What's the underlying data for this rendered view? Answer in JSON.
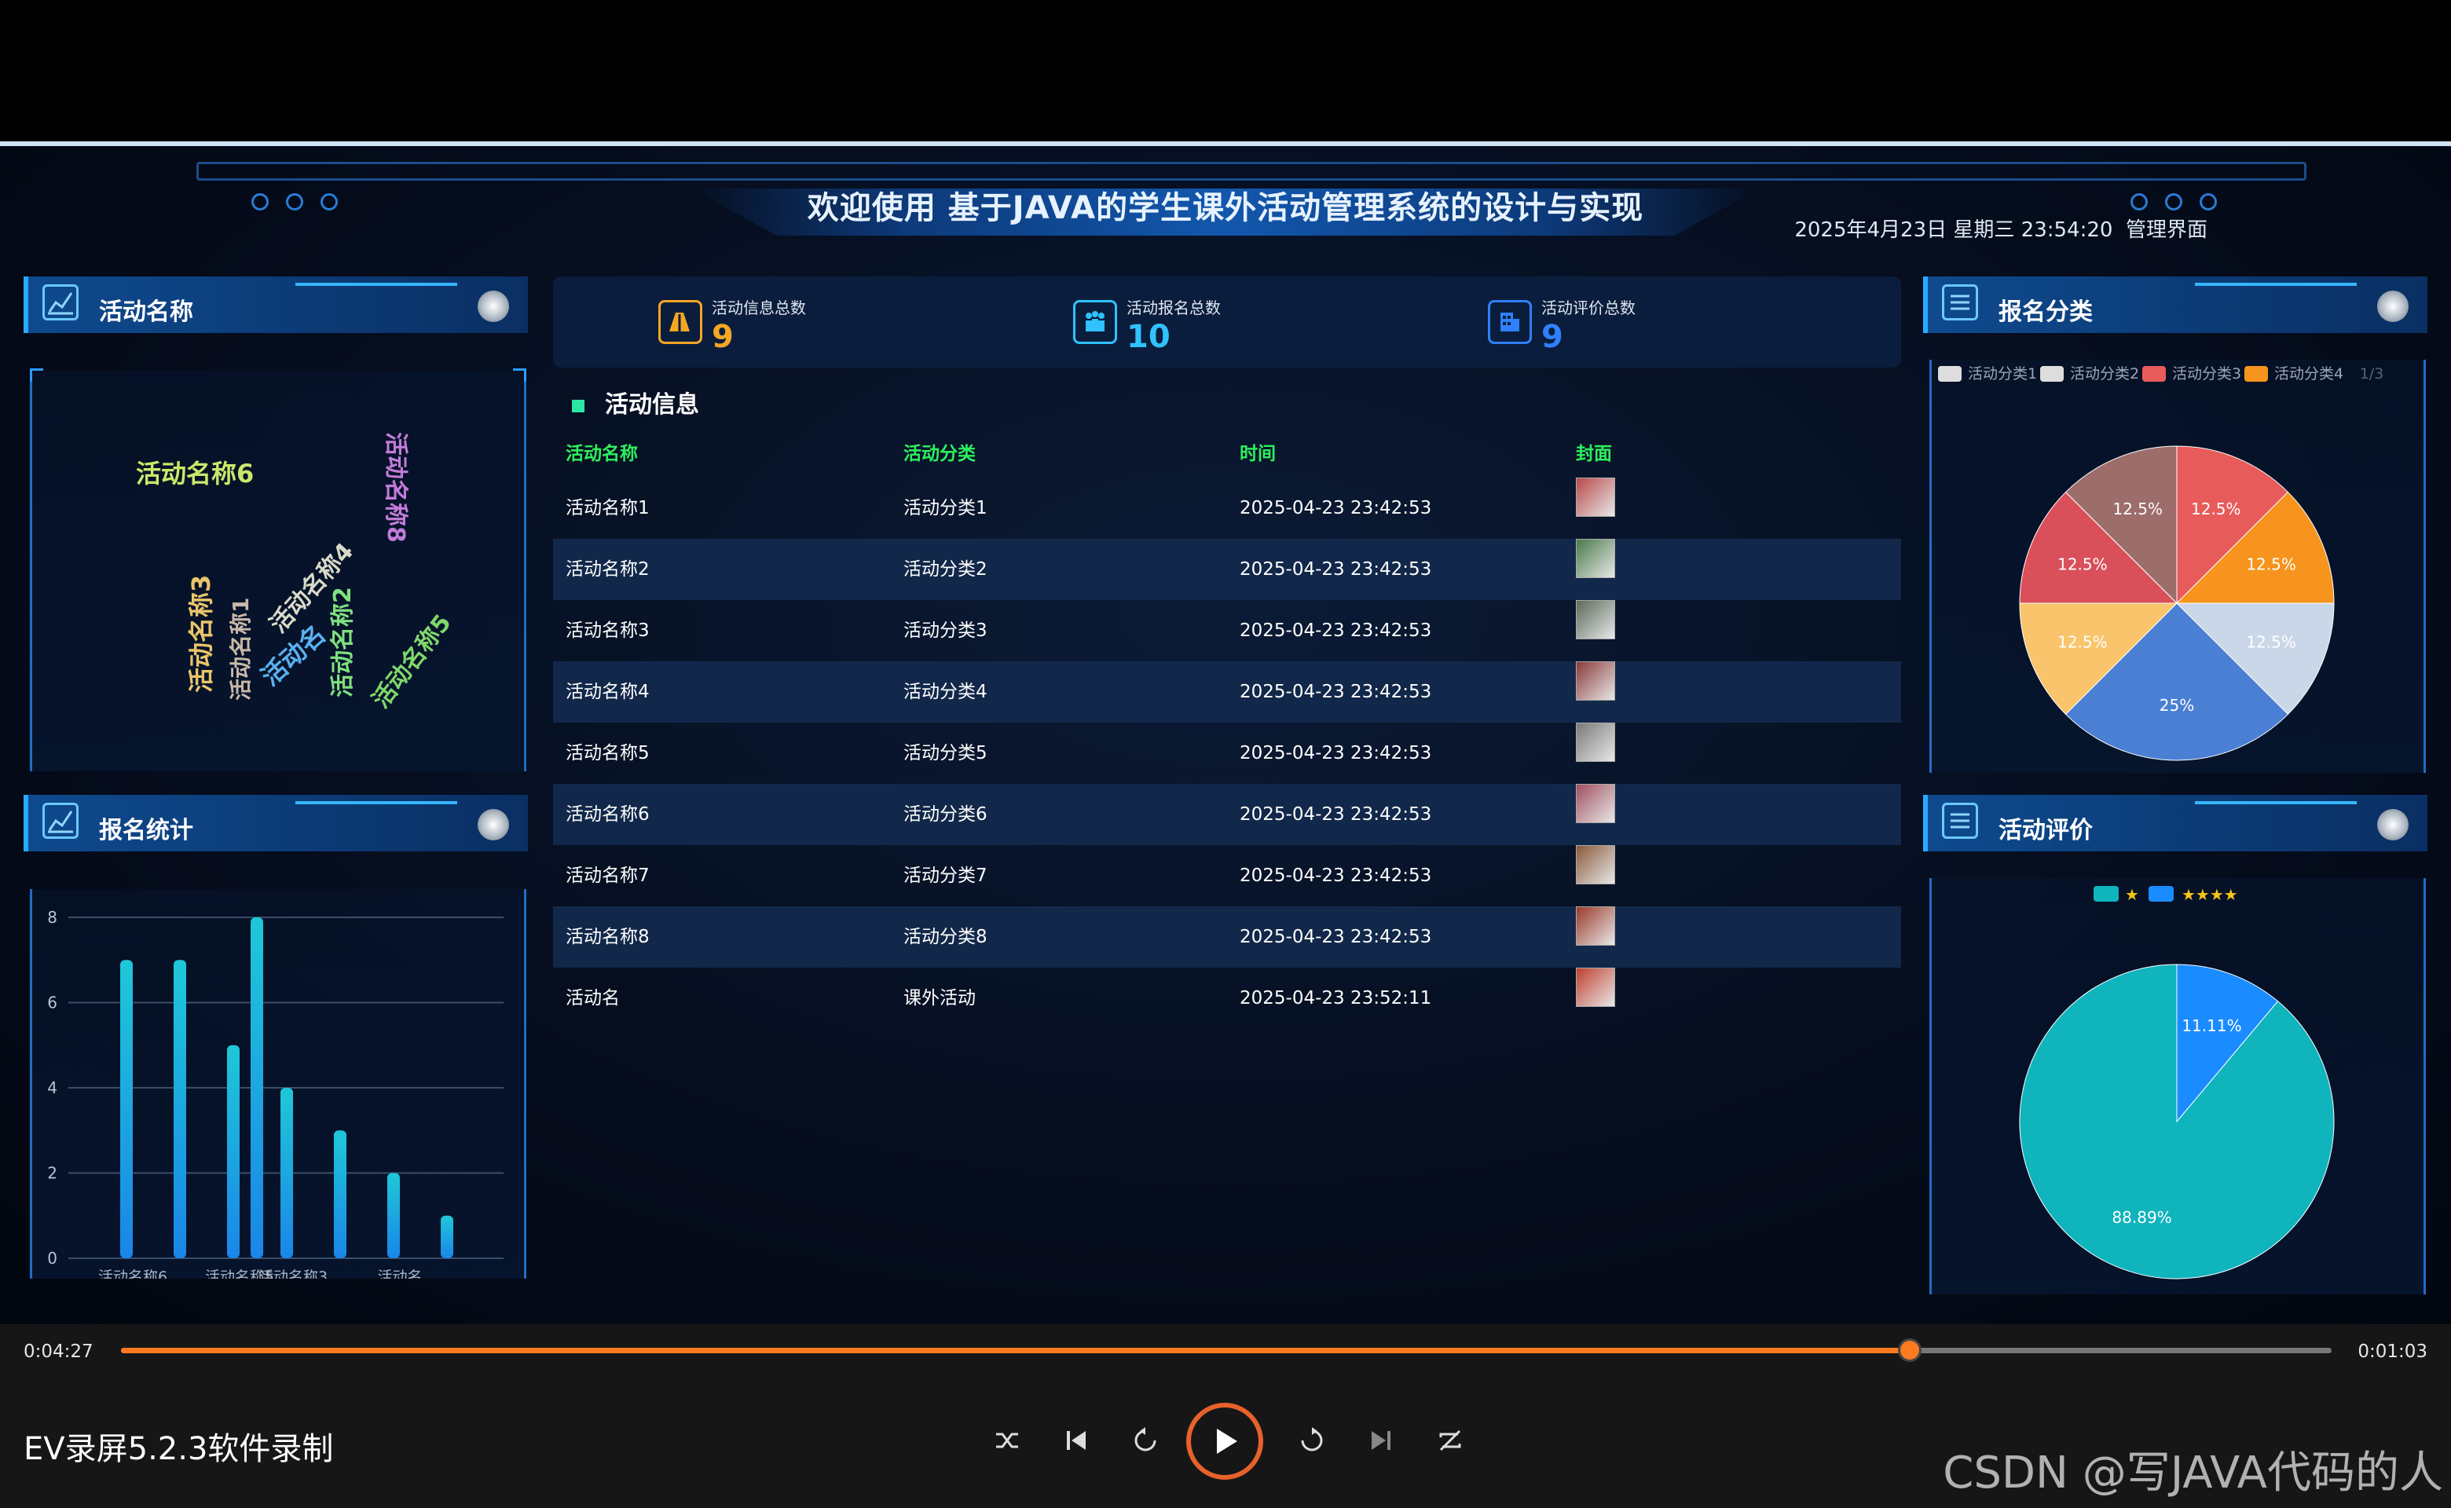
{
  "header": {
    "title": "欢迎使用 基于JAVA的学生课外活动管理系统的设计与实现",
    "datetime": "2025年4月23日 星期三 23:54:20",
    "admin_link": "管理界面"
  },
  "panels": {
    "activity_name": {
      "title": "活动名称"
    },
    "signup_stats": {
      "title": "报名统计"
    },
    "signup_category": {
      "title": "报名分类"
    },
    "activity_rating": {
      "title": "活动评价"
    }
  },
  "word_cloud": [
    {
      "text": "活动名称6",
      "color": "#c8e86a"
    },
    {
      "text": "活动名称3",
      "color": "#e9c46a"
    },
    {
      "text": "活动名称1",
      "color": "#c9b8a8"
    },
    {
      "text": "活动名",
      "color": "#5ab0f0"
    },
    {
      "text": "活动名称4",
      "color": "#d9d9c8"
    },
    {
      "text": "活动名称2",
      "color": "#7ee07e"
    },
    {
      "text": "活动名称8",
      "color": "#c27bd8"
    },
    {
      "text": "活动名称5",
      "color": "#7fd86a"
    }
  ],
  "stats": [
    {
      "label": "活动信息总数",
      "value": "9",
      "color": "#f5a623",
      "icon": "building-icon"
    },
    {
      "label": "活动报名总数",
      "value": "10",
      "color": "#2fc2ff",
      "icon": "people-icon"
    },
    {
      "label": "活动评价总数",
      "value": "9",
      "color": "#2f80ff",
      "icon": "office-icon"
    }
  ],
  "table": {
    "section_title": "活动信息",
    "headers": [
      "活动名称",
      "活动分类",
      "时间",
      "封面"
    ],
    "rows": [
      {
        "name": "活动名称1",
        "category": "活动分类1",
        "time": "2025-04-23 23:42:53"
      },
      {
        "name": "活动名称2",
        "category": "活动分类2",
        "time": "2025-04-23 23:42:53"
      },
      {
        "name": "活动名称3",
        "category": "活动分类3",
        "time": "2025-04-23 23:42:53"
      },
      {
        "name": "活动名称4",
        "category": "活动分类4",
        "time": "2025-04-23 23:42:53"
      },
      {
        "name": "活动名称5",
        "category": "活动分类5",
        "time": "2025-04-23 23:42:53"
      },
      {
        "name": "活动名称6",
        "category": "活动分类6",
        "time": "2025-04-23 23:42:53"
      },
      {
        "name": "活动名称7",
        "category": "活动分类7",
        "time": "2025-04-23 23:42:53"
      },
      {
        "name": "活动名称8",
        "category": "活动分类8",
        "time": "2025-04-23 23:42:53"
      },
      {
        "name": "活动名",
        "category": "课外活动",
        "time": "2025-04-23 23:52:11"
      }
    ]
  },
  "chart_data": [
    {
      "type": "bar",
      "title": "报名统计",
      "categories": [
        "活动名称6",
        "",
        "活动名称5",
        "",
        "活动名称3",
        "",
        "活动名",
        ""
      ],
      "values": [
        7,
        7,
        5,
        8,
        4,
        3,
        2,
        1
      ],
      "ylim": [
        0,
        8
      ],
      "yticks": [
        "0",
        "2",
        "4",
        "6",
        "8"
      ],
      "grid": true,
      "colors": [
        "#1ec8d8",
        "#1a86e8"
      ]
    },
    {
      "type": "pie",
      "title": "报名分类",
      "legend": [
        "活动分类1",
        "活动分类2",
        "活动分类3",
        "活动分类4"
      ],
      "legend_page": "1/3",
      "slices": [
        {
          "label": "12.5%",
          "value": 12.5,
          "color": "#e85b5b"
        },
        {
          "label": "12.5%",
          "value": 12.5,
          "color": "#f7941d"
        },
        {
          "label": "12.5%",
          "value": 12.5,
          "color": "#c9d7e8"
        },
        {
          "label": "25%",
          "value": 25,
          "color": "#4a7fd4"
        },
        {
          "label": "12.5%",
          "value": 12.5,
          "color": "#f9c46b"
        },
        {
          "label": "12.5%",
          "value": 12.5,
          "color": "#d9505a"
        },
        {
          "label": "12.5%",
          "value": 12.5,
          "color": "#9c6d6a"
        }
      ]
    },
    {
      "type": "pie",
      "title": "活动评价",
      "legend": [
        "★",
        "★★★★"
      ],
      "legend_colors": [
        "#0fb4bd",
        "#1a8cff"
      ],
      "slices": [
        {
          "label": "11.11%",
          "value": 11.11,
          "color": "#1a8cff"
        },
        {
          "label": "88.89%",
          "value": 88.89,
          "color": "#0fb4bd"
        }
      ]
    }
  ],
  "player": {
    "elapsed": "0:04:27",
    "remaining": "0:01:03",
    "progress": 0.809,
    "app_name": "EV录屏5.2.3软件录制",
    "watermark": "CSDN @写JAVA代码的人"
  }
}
